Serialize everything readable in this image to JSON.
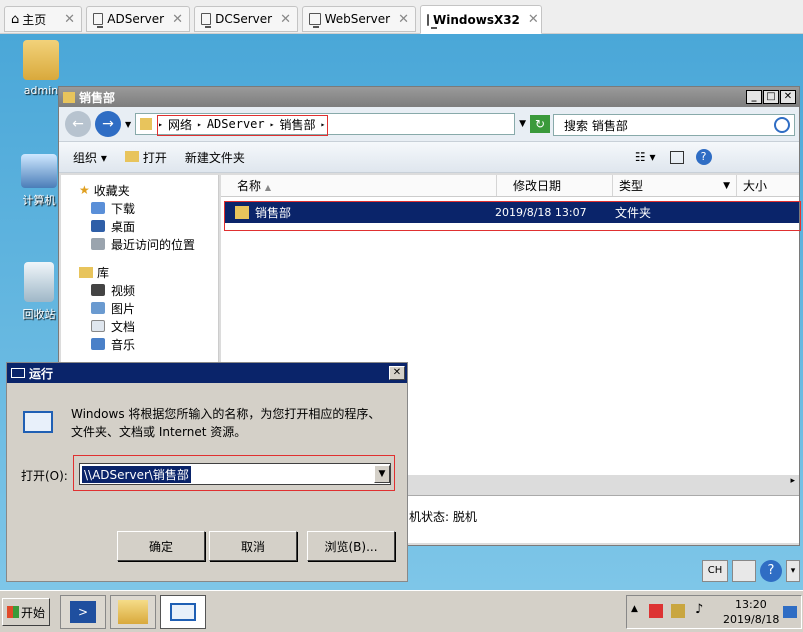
{
  "host_tabs": [
    {
      "label": "主页"
    },
    {
      "label": "ADServer"
    },
    {
      "label": "DCServer"
    },
    {
      "label": "WebServer"
    },
    {
      "label": "WindowsX32"
    }
  ],
  "desktop_icons": [
    {
      "label": "admin"
    },
    {
      "label": "计算机"
    },
    {
      "label": "回收站"
    }
  ],
  "explorer": {
    "title": "销售部",
    "breadcrumb": [
      "网络",
      "ADServer",
      "销售部"
    ],
    "search_placeholder": "搜索 销售部",
    "toolbar": {
      "organize": "组织",
      "open": "打开",
      "new_folder": "新建文件夹"
    },
    "nav": {
      "favorites": "收藏夹",
      "favorites_items": [
        "下载",
        "桌面",
        "最近访问的位置"
      ],
      "libraries": "库",
      "libraries_items": [
        "视频",
        "图片",
        "文档",
        "音乐"
      ]
    },
    "columns": {
      "name": "名称",
      "modified": "修改日期",
      "type": "类型",
      "size": "大小"
    },
    "files": [
      {
        "name": "销售部",
        "modified": "2019/8/18 13:07",
        "type": "文件夹"
      }
    ],
    "details_status": "机状态: 脱机"
  },
  "run_dialog": {
    "title": "运行",
    "description": "Windows 将根据您所输入的名称，为您打开相应的程序、文件夹、文档或 Internet 资源。",
    "open_label": "打开(O):",
    "open_value": "\\\\ADServer\\销售部",
    "buttons": {
      "ok": "确定",
      "cancel": "取消",
      "browse": "浏览(B)..."
    }
  },
  "taskbar": {
    "start_label": "开始",
    "lang": "CH",
    "clock_time": "13:20",
    "clock_date": "2019/8/18"
  }
}
